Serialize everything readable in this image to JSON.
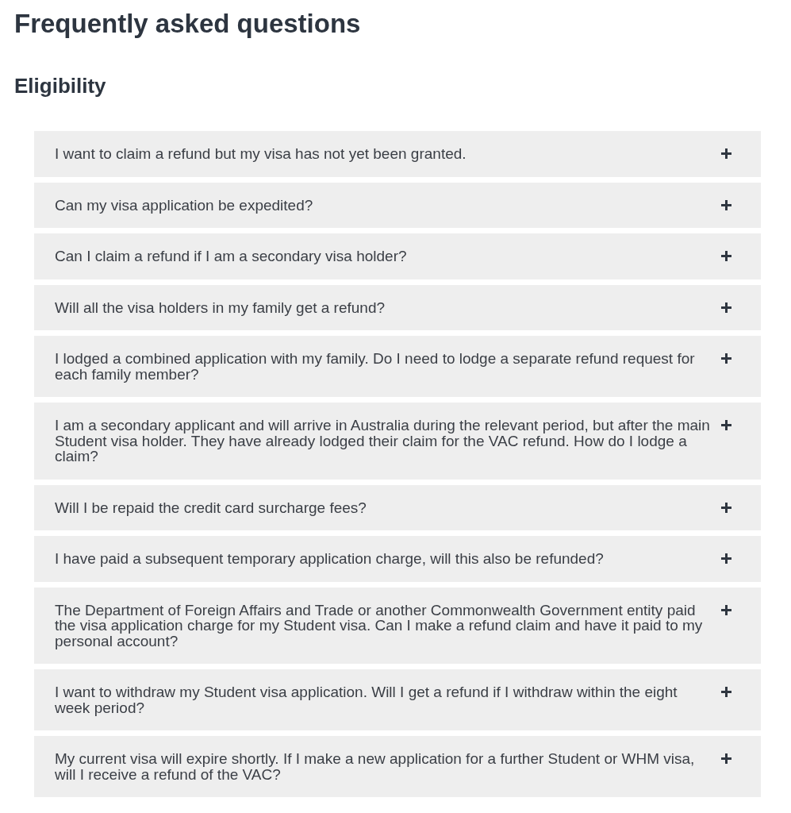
{
  "page": {
    "title": "Frequently asked questions"
  },
  "section": {
    "heading": "Eligibility",
    "questions": [
      {
        "text": "I want to claim a refund but my visa has not yet been granted.",
        "expanded": false
      },
      {
        "text": "Can my visa application be expedited?",
        "expanded": false
      },
      {
        "text": "Can I claim a refund if I am a secondary visa holder?",
        "expanded": false
      },
      {
        "text": "Will all the visa holders in my family get a refund?",
        "expanded": false
      },
      {
        "text": "I lodged a combined application with my family. Do I need to lodge a separate refund request for each family member?",
        "expanded": false
      },
      {
        "text": "I am a secondary applicant and will arrive in Australia during the relevant period, but after the main Student visa holder. They have already lodged their claim for the VAC refund. How do I lodge a claim?",
        "expanded": false
      },
      {
        "text": "Will I be repaid the credit card surcharge fees?",
        "expanded": false
      },
      {
        "text": "I have paid a subsequent temporary application charge, will this also be refunded?",
        "expanded": false
      },
      {
        "text": "The Department of Foreign Affairs and Trade or another Commonwealth Government entity paid the visa application charge for my Student visa. Can I make a refund claim and have it paid to my personal account?",
        "expanded": false
      },
      {
        "text": "I want to withdraw my Student visa application. Will I get a refund if I withdraw within the eight week period?",
        "expanded": false
      },
      {
        "text": "My current visa will expire shortly. If I make a new application for a further Student or WHM visa, will I receive a refund of the VAC?",
        "expanded": false
      }
    ]
  }
}
